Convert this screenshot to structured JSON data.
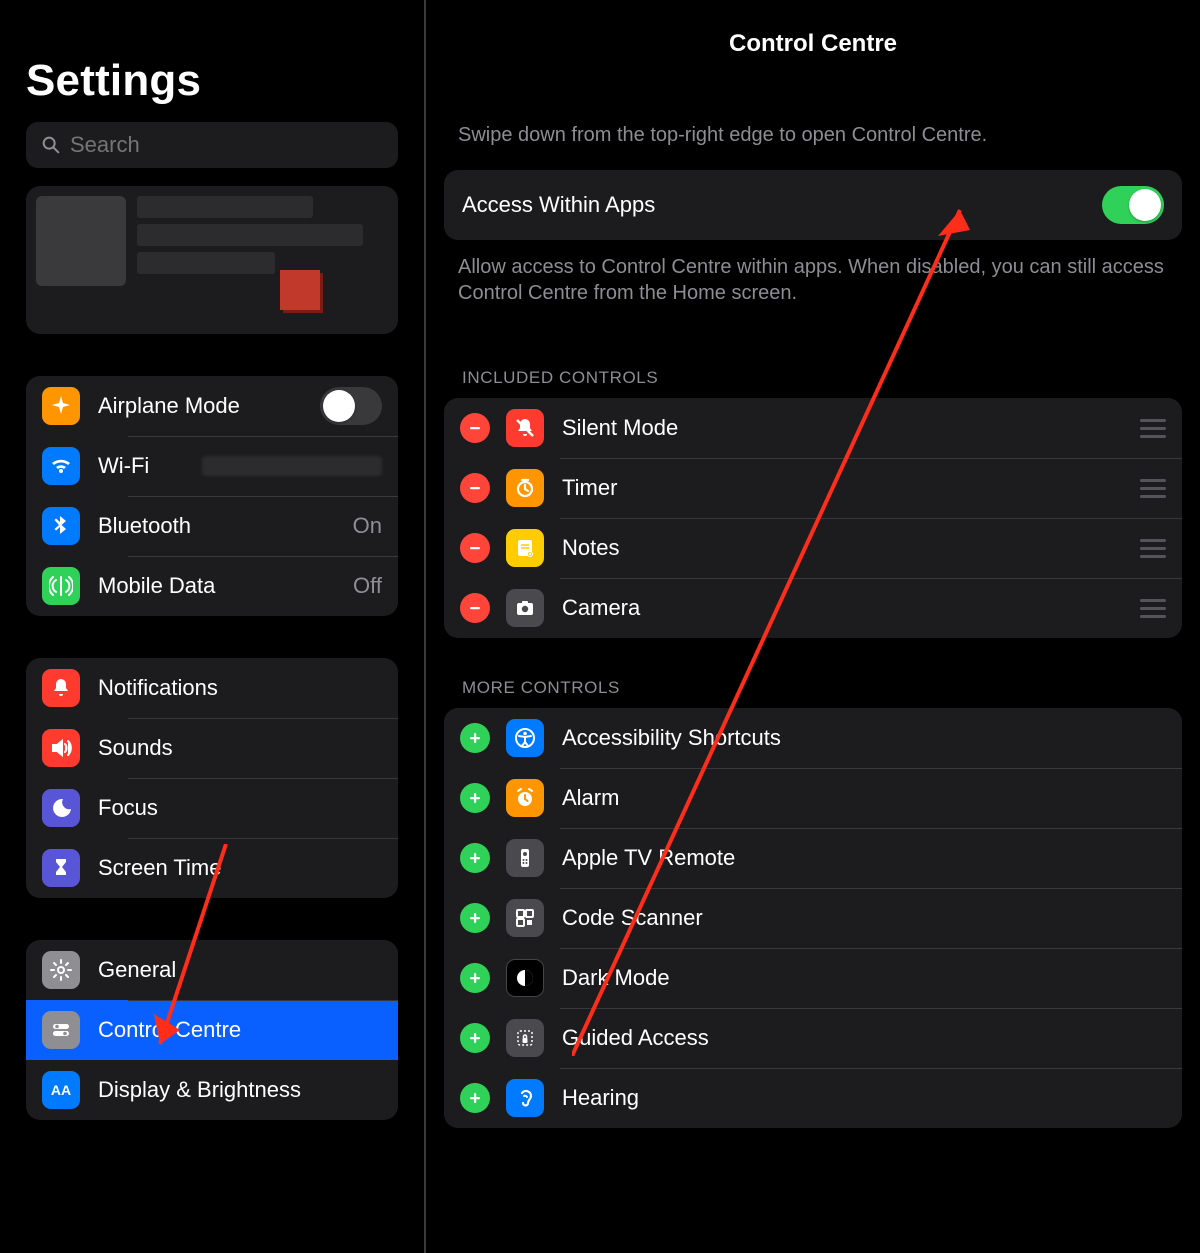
{
  "sidebar": {
    "title": "Settings",
    "search_placeholder": "Search",
    "groups": [
      [
        {
          "key": "airplane",
          "label": "Airplane Mode",
          "icon": "airplane-icon",
          "bg": "bg-orange",
          "type": "toggle",
          "on": false
        },
        {
          "key": "wifi",
          "label": "Wi-Fi",
          "icon": "wifi-icon",
          "bg": "bg-blue",
          "type": "value-blur"
        },
        {
          "key": "bluetooth",
          "label": "Bluetooth",
          "icon": "bluetooth-icon",
          "bg": "bg-blue",
          "type": "value",
          "value": "On"
        },
        {
          "key": "mobiledata",
          "label": "Mobile Data",
          "icon": "antenna-icon",
          "bg": "bg-green",
          "type": "value",
          "value": "Off"
        }
      ],
      [
        {
          "key": "notifications",
          "label": "Notifications",
          "icon": "bell-icon",
          "bg": "bg-red",
          "type": "nav"
        },
        {
          "key": "sounds",
          "label": "Sounds",
          "icon": "speaker-icon",
          "bg": "bg-red",
          "type": "nav"
        },
        {
          "key": "focus",
          "label": "Focus",
          "icon": "moon-icon",
          "bg": "bg-indigo",
          "type": "nav"
        },
        {
          "key": "screentime",
          "label": "Screen Time",
          "icon": "hourglass-icon",
          "bg": "bg-indigo",
          "type": "nav"
        }
      ],
      [
        {
          "key": "general",
          "label": "General",
          "icon": "gear-icon",
          "bg": "bg-grey",
          "type": "nav"
        },
        {
          "key": "controlcentre",
          "label": "Control Centre",
          "icon": "switches-icon",
          "bg": "bg-grey",
          "type": "nav",
          "selected": true
        },
        {
          "key": "display",
          "label": "Display & Brightness",
          "icon": "aa-icon",
          "bg": "bg-blue",
          "type": "nav"
        }
      ]
    ]
  },
  "main": {
    "title": "Control Centre",
    "intro": "Swipe down from the top-right edge to open Control Centre.",
    "access_label": "Access Within Apps",
    "access_on": true,
    "access_desc": "Allow access to Control Centre within apps. When disabled, you can still access Control Centre from the Home screen.",
    "included_header": "INCLUDED CONTROLS",
    "more_header": "MORE CONTROLS",
    "included": [
      {
        "key": "silent",
        "label": "Silent Mode",
        "icon": "bell-slash-icon",
        "bg": "bg-red"
      },
      {
        "key": "timer",
        "label": "Timer",
        "icon": "timer-icon",
        "bg": "bg-orange"
      },
      {
        "key": "notes",
        "label": "Notes",
        "icon": "notes-icon",
        "bg": "bg-yellow"
      },
      {
        "key": "camera",
        "label": "Camera",
        "icon": "camera-icon",
        "bg": "bg-dgrey"
      }
    ],
    "more": [
      {
        "key": "accessibility",
        "label": "Accessibility Shortcuts",
        "icon": "accessibility-icon",
        "bg": "bg-blue"
      },
      {
        "key": "alarm",
        "label": "Alarm",
        "icon": "alarm-icon",
        "bg": "bg-orange"
      },
      {
        "key": "appletv",
        "label": "Apple TV Remote",
        "icon": "remote-icon",
        "bg": "bg-dgrey"
      },
      {
        "key": "codescanner",
        "label": "Code Scanner",
        "icon": "qr-icon",
        "bg": "bg-dgrey"
      },
      {
        "key": "darkmode",
        "label": "Dark Mode",
        "icon": "darkmode-icon",
        "bg": "bg-black"
      },
      {
        "key": "guidedaccess",
        "label": "Guided Access",
        "icon": "lock-icon",
        "bg": "bg-dgrey"
      },
      {
        "key": "hearing",
        "label": "Hearing",
        "icon": "ear-icon",
        "bg": "bg-blue"
      }
    ]
  }
}
